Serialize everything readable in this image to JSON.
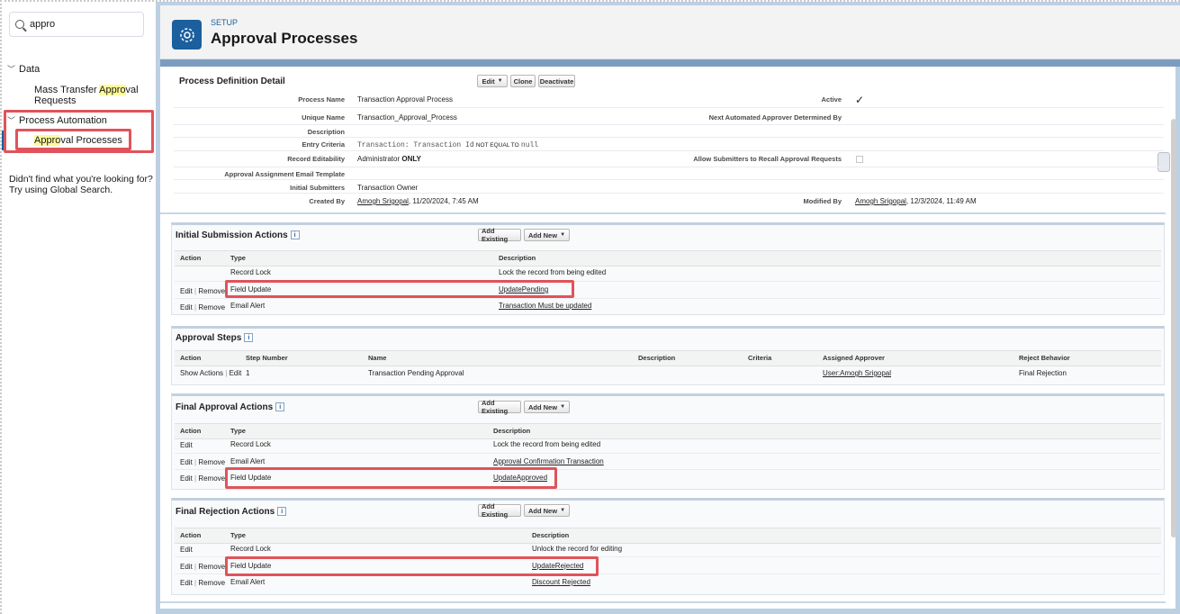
{
  "sidebar": {
    "search_value": "appro",
    "data_group": "Data",
    "mass_transfer_pre": "Mass Transfer ",
    "mass_transfer_hl": "Appro",
    "mass_transfer_post": "val",
    "mass_transfer_line2": "Requests",
    "process_automation": "Process Automation",
    "approval_hl": "Appro",
    "approval_post": "val Processes",
    "help_line1": "Didn't find what you're looking for?",
    "help_line2": "Try using Global Search."
  },
  "header": {
    "setup": "SETUP",
    "title": "Approval Processes"
  },
  "detail": {
    "title": "Process Definition Detail",
    "buttons": {
      "edit": "Edit",
      "clone": "Clone",
      "deactivate": "Deactivate"
    },
    "fields": {
      "process_name_label": "Process Name",
      "process_name": "Transaction Approval Process",
      "unique_name_label": "Unique Name",
      "unique_name": "Transaction_Approval_Process",
      "description_label": "Description",
      "entry_criteria_label": "Entry Criteria",
      "entry_criteria_a": "Transaction: Transaction Id",
      "entry_criteria_op": "NOT EQUAL TO",
      "entry_criteria_b": "null",
      "record_editability_label": "Record Editability",
      "record_editability_a": "Administrator",
      "record_editability_b": "ONLY",
      "email_template_label": "Approval Assignment Email Template",
      "initial_submitters_label": "Initial Submitters",
      "initial_submitters": "Transaction Owner",
      "created_by_label": "Created By",
      "created_by_link": "Amogh Srigopal",
      "created_by_date": ", 11/20/2024, 7:45 AM",
      "active_label": "Active",
      "active_mark": "✓",
      "next_approver_label": "Next Automated Approver Determined By",
      "allow_recall_label": "Allow Submitters to Recall Approval Requests",
      "modified_by_label": "Modified By",
      "modified_by_link": "Amogh Srigopal",
      "modified_by_date": ", 12/3/2024, 11:49 AM"
    }
  },
  "common": {
    "add_existing": "Add Existing",
    "add_new": "Add New",
    "info": "i",
    "caret": "▼",
    "col_action": "Action",
    "col_type": "Type",
    "col_description": "Description",
    "edit": "Edit",
    "remove": "Remove",
    "sep": " | "
  },
  "initial_submission": {
    "title": "Initial Submission Actions",
    "rows": [
      {
        "type": "Record Lock",
        "desc": "Lock the record from being edited"
      },
      {
        "type": "Field Update",
        "desc": "UpdatePending"
      },
      {
        "type": "Email Alert",
        "desc": "Transaction Must be updated"
      }
    ]
  },
  "approval_steps": {
    "title": "Approval Steps",
    "headers": {
      "action": "Action",
      "step_number": "Step Number",
      "name": "Name",
      "description": "Description",
      "criteria": "Criteria",
      "assigned_approver": "Assigned Approver",
      "reject_behavior": "Reject Behavior"
    },
    "row": {
      "show_actions": "Show Actions",
      "edit": "Edit",
      "step": "1",
      "name": "Transaction Pending Approval",
      "approver": "User:Amogh Srigopal",
      "reject": "Final Rejection"
    }
  },
  "final_approval": {
    "title": "Final Approval Actions",
    "rows": [
      {
        "type": "Record Lock",
        "desc": "Lock the record from being edited"
      },
      {
        "type": "Email Alert",
        "desc": "Approval Confirmation Transaction"
      },
      {
        "type": "Field Update",
        "desc": "UpdateApproved"
      }
    ]
  },
  "final_rejection": {
    "title": "Final Rejection Actions",
    "rows": [
      {
        "type": "Record Lock",
        "desc": "Unlock the record for editing"
      },
      {
        "type": "Field Update",
        "desc": "UpdateRejected"
      },
      {
        "type": "Email Alert",
        "desc": "Discount Rejected"
      }
    ]
  },
  "colors": {
    "accent": "#1b5f9e",
    "highlight_box": "#e0535a",
    "search_highlight": "#fdfb9a"
  }
}
